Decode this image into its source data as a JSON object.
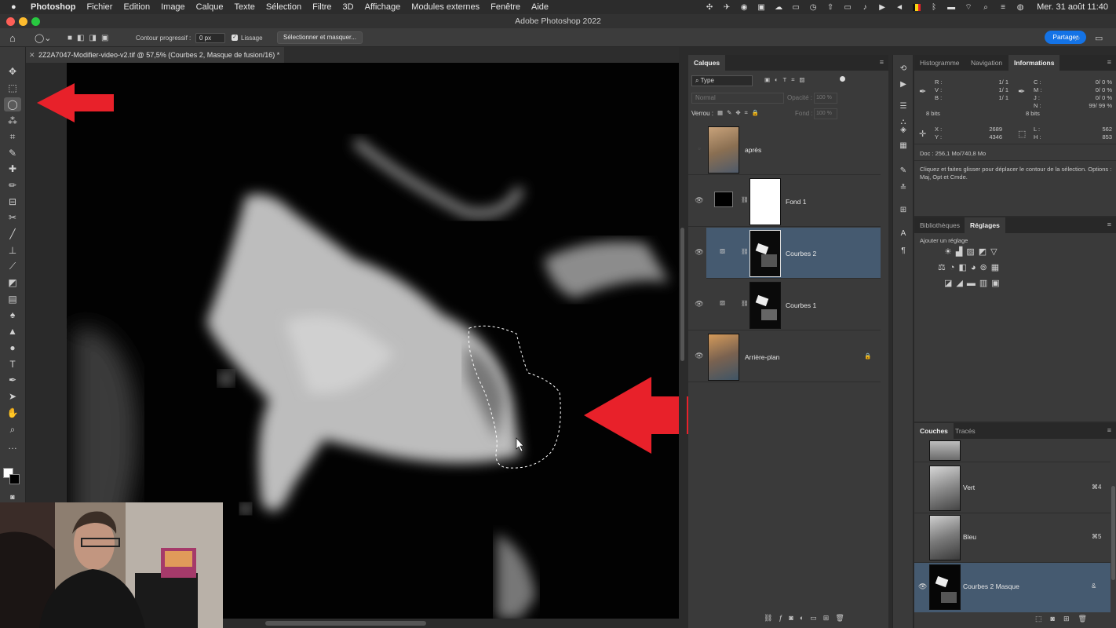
{
  "menubar": {
    "items": [
      "Photoshop",
      "Fichier",
      "Edition",
      "Image",
      "Calque",
      "Texte",
      "Sélection",
      "Filtre",
      "3D",
      "Affichage",
      "Modules externes",
      "Fenêtre",
      "Aide"
    ],
    "clock": "Mer. 31 août  11:40"
  },
  "window": {
    "title": "Adobe Photoshop 2022"
  },
  "options": {
    "feather_label": "Contour progressif :",
    "feather_value": "0 px",
    "smoothing_label": "Lissage",
    "select_mask_label": "Sélectionner et masquer...",
    "share_label": "Partager"
  },
  "document": {
    "tab_title": "2Z2A7047-Modifier-video-v2.tif @ 57,5% (Courbes 2, Masque de fusion/16) *"
  },
  "layers_panel": {
    "tab": "Calques",
    "filter_label": "Type",
    "blend_mode": "Normal",
    "opacity_label": "Opacité :",
    "opacity_value": "100 %",
    "lock_label": "Verrou :",
    "fill_label": "Fond :",
    "fill_value": "100 %",
    "layers": [
      {
        "name": "après",
        "visible": false,
        "selected": false
      },
      {
        "name": "Fond 1",
        "visible": true,
        "selected": false
      },
      {
        "name": "Courbes 2",
        "visible": true,
        "selected": true
      },
      {
        "name": "Courbes 1",
        "visible": true,
        "selected": false
      },
      {
        "name": "Arrière-plan",
        "visible": true,
        "selected": false,
        "locked": true
      }
    ]
  },
  "info_panel": {
    "tabs": [
      "Histogramme",
      "Navigation",
      "Informations"
    ],
    "active_tab": "Informations",
    "rgb": {
      "R": "1/   1",
      "V": "1/   1",
      "B": "1/   1"
    },
    "cmjn": {
      "C": "0/   0 %",
      "M": "0/   0 %",
      "J": "0/   0 %",
      "N": "99/  99 %"
    },
    "bits_left": "8 bits",
    "bits_right": "8 bits",
    "X": "2689",
    "Y": "4346",
    "L": "562",
    "H": "853",
    "doc": "Doc : 256,1 Mo/740,8 Mo",
    "hint": "Cliquez et faites glisser pour déplacer le contour de la sélection. Options : Maj, Opt et Cmde."
  },
  "adjust_panel": {
    "tabs": [
      "Bibliothèques",
      "Réglages"
    ],
    "active_tab": "Réglages",
    "title": "Ajouter un réglage"
  },
  "channels_panel": {
    "tabs": [
      "Couches",
      "Tracés"
    ],
    "active_tab": "Couches",
    "channels": [
      {
        "name": "",
        "shortcut": ""
      },
      {
        "name": "Vert",
        "shortcut": "⌘4"
      },
      {
        "name": "Bleu",
        "shortcut": "⌘5"
      },
      {
        "name": "Courbes 2 Masque",
        "shortcut": "&",
        "selected": true
      }
    ]
  },
  "colors": {
    "accent": "#1473e6",
    "selection": "#455a70",
    "arrow": "#e8212a"
  }
}
